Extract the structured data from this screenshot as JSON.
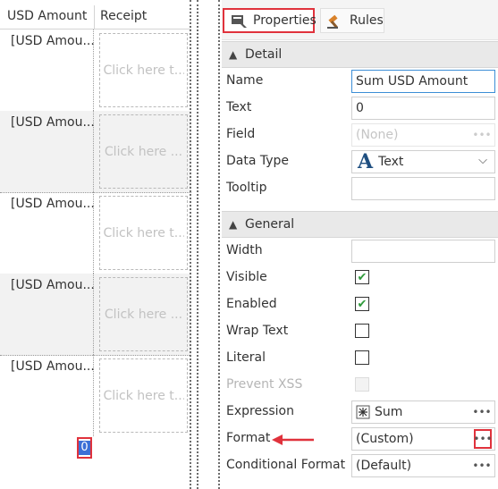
{
  "grid": {
    "headers": {
      "usd": "USD Amount",
      "receipt": "Receipt"
    },
    "rows": [
      {
        "usd": "[USD Amou...",
        "receipt": "Click here t..."
      },
      {
        "usd": "[USD Amou...",
        "receipt": "Click here ..."
      },
      {
        "usd": "[USD Amou...",
        "receipt": "Click here t..."
      },
      {
        "usd": "[USD Amou...",
        "receipt": "Click here ..."
      },
      {
        "usd": "[USD Amou...",
        "receipt": "Click here t..."
      }
    ],
    "total_value": "0"
  },
  "tabs": {
    "properties": "Properties",
    "rules": "Rules"
  },
  "sections": {
    "detail": "Detail",
    "general": "General"
  },
  "detail": {
    "name_label": "Name",
    "name_value": "Sum USD Amount",
    "text_label": "Text",
    "text_value": "0",
    "field_label": "Field",
    "field_value": "(None)",
    "datatype_label": "Data Type",
    "datatype_value": "Text",
    "tooltip_label": "Tooltip",
    "tooltip_value": ""
  },
  "general": {
    "width_label": "Width",
    "width_value": "",
    "visible_label": "Visible",
    "visible_checked": true,
    "enabled_label": "Enabled",
    "enabled_checked": true,
    "wraptext_label": "Wrap Text",
    "wraptext_checked": false,
    "literal_label": "Literal",
    "literal_checked": false,
    "preventxss_label": "Prevent XSS",
    "preventxss_checked": false,
    "expression_label": "Expression",
    "expression_value": "Sum",
    "format_label": "Format",
    "format_value": "(Custom)",
    "condformat_label": "Conditional Format",
    "condformat_value": "(Default)"
  },
  "icons": {
    "properties": "properties-icon",
    "rules": "gavel-icon",
    "datatype": "text-a-icon",
    "expression": "sigma-icon",
    "ellipsis": "ellipsis-icon"
  },
  "colors": {
    "highlight": "#e0323c",
    "focus": "#3c8ed6",
    "check": "#2e9a3a",
    "selected": "#3d6fd6"
  }
}
